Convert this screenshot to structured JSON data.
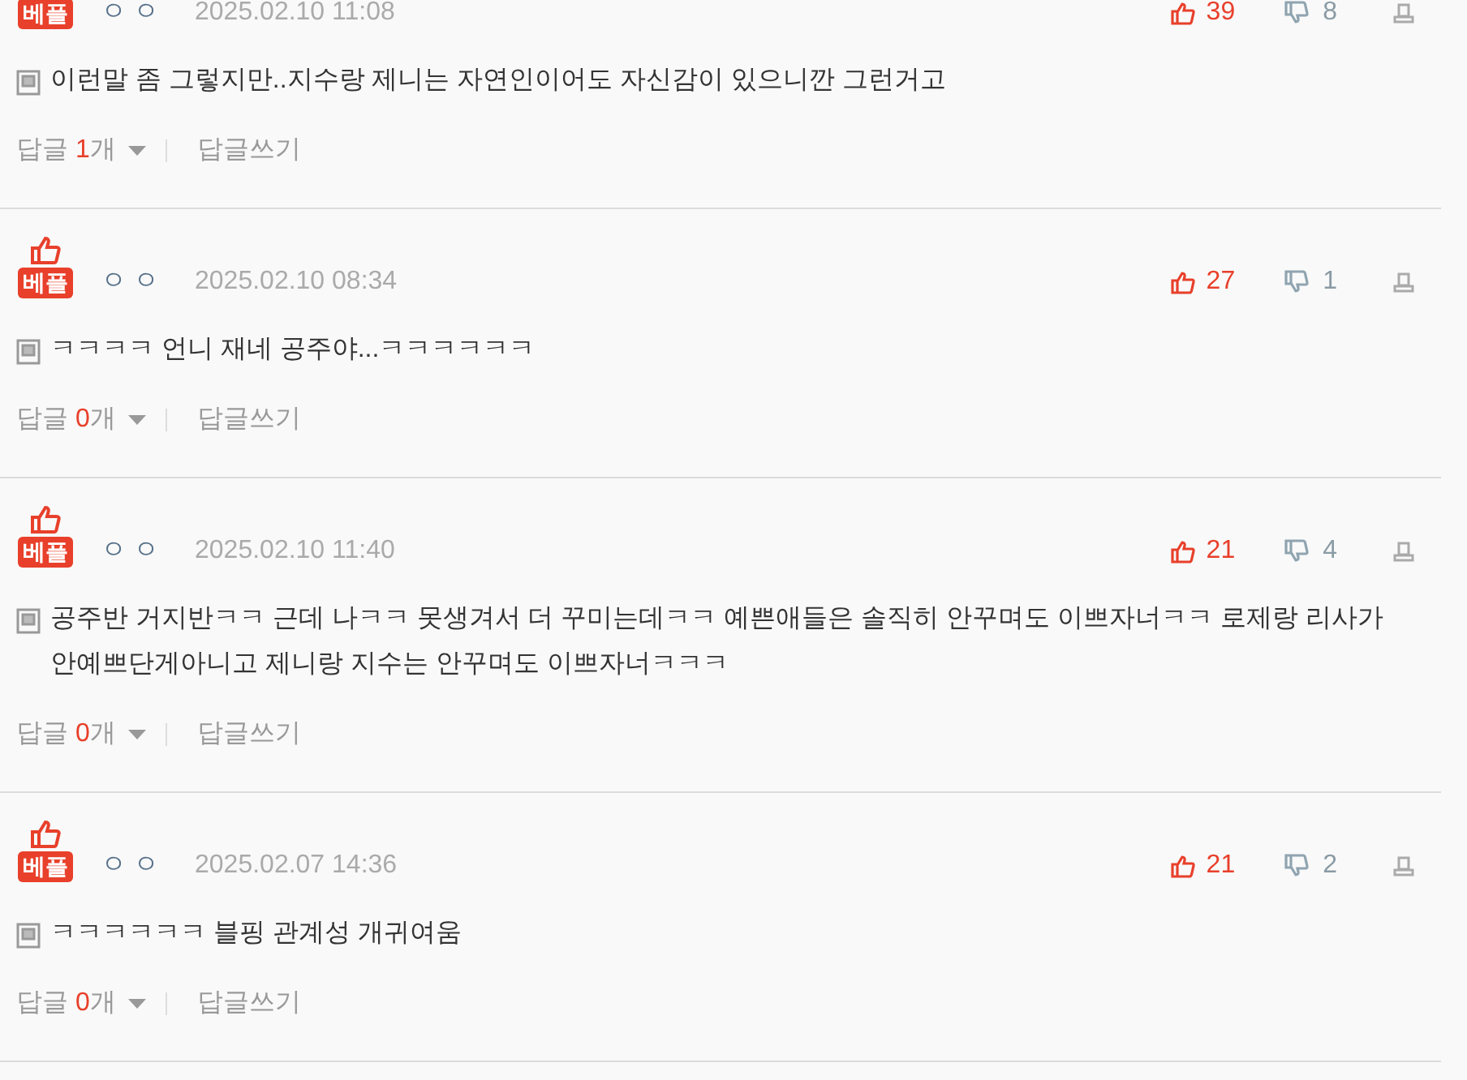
{
  "comments": [
    {
      "thumb": false,
      "badge": "베플",
      "author": "ㅇㅇ",
      "date": "2025.02.10 11:08",
      "likes": "39",
      "dislikes": "8",
      "text": "이런말 좀 그렇지만..지수랑 제니는 자연인이어도 자신감이 있으니깐 그런거고",
      "reply_label": "답글",
      "reply_count": "1",
      "reply_unit": "개",
      "write": "답글쓰기"
    },
    {
      "thumb": true,
      "badge": "베플",
      "author": "ㅇㅇ",
      "date": "2025.02.10 08:34",
      "likes": "27",
      "dislikes": "1",
      "text": "ㅋㅋㅋㅋ 언니 재네 공주야...ㅋㅋㅋㅋㅋㅋ",
      "reply_label": "답글",
      "reply_count": "0",
      "reply_unit": "개",
      "write": "답글쓰기"
    },
    {
      "thumb": true,
      "badge": "베플",
      "author": "ㅇㅇ",
      "date": "2025.02.10 11:40",
      "likes": "21",
      "dislikes": "4",
      "text": "공주반 거지반ㅋㅋ 근데 나ㅋㅋ 못생겨서 더 꾸미는데ㅋㅋ 예쁜애들은 솔직히 안꾸며도 이쁘자너ㅋㅋ 로제랑 리사가 안예쁘단게아니고 제니랑 지수는 안꾸며도 이쁘자너ㅋㅋㅋ",
      "reply_label": "답글",
      "reply_count": "0",
      "reply_unit": "개",
      "write": "답글쓰기"
    },
    {
      "thumb": true,
      "badge": "베플",
      "author": "ㅇㅇ",
      "date": "2025.02.07 14:36",
      "likes": "21",
      "dislikes": "2",
      "text": "ㅋㅋㅋㅋㅋㅋ 블핑 관계성 개귀여움",
      "reply_label": "답글",
      "reply_count": "0",
      "reply_unit": "개",
      "write": "답글쓰기"
    }
  ]
}
